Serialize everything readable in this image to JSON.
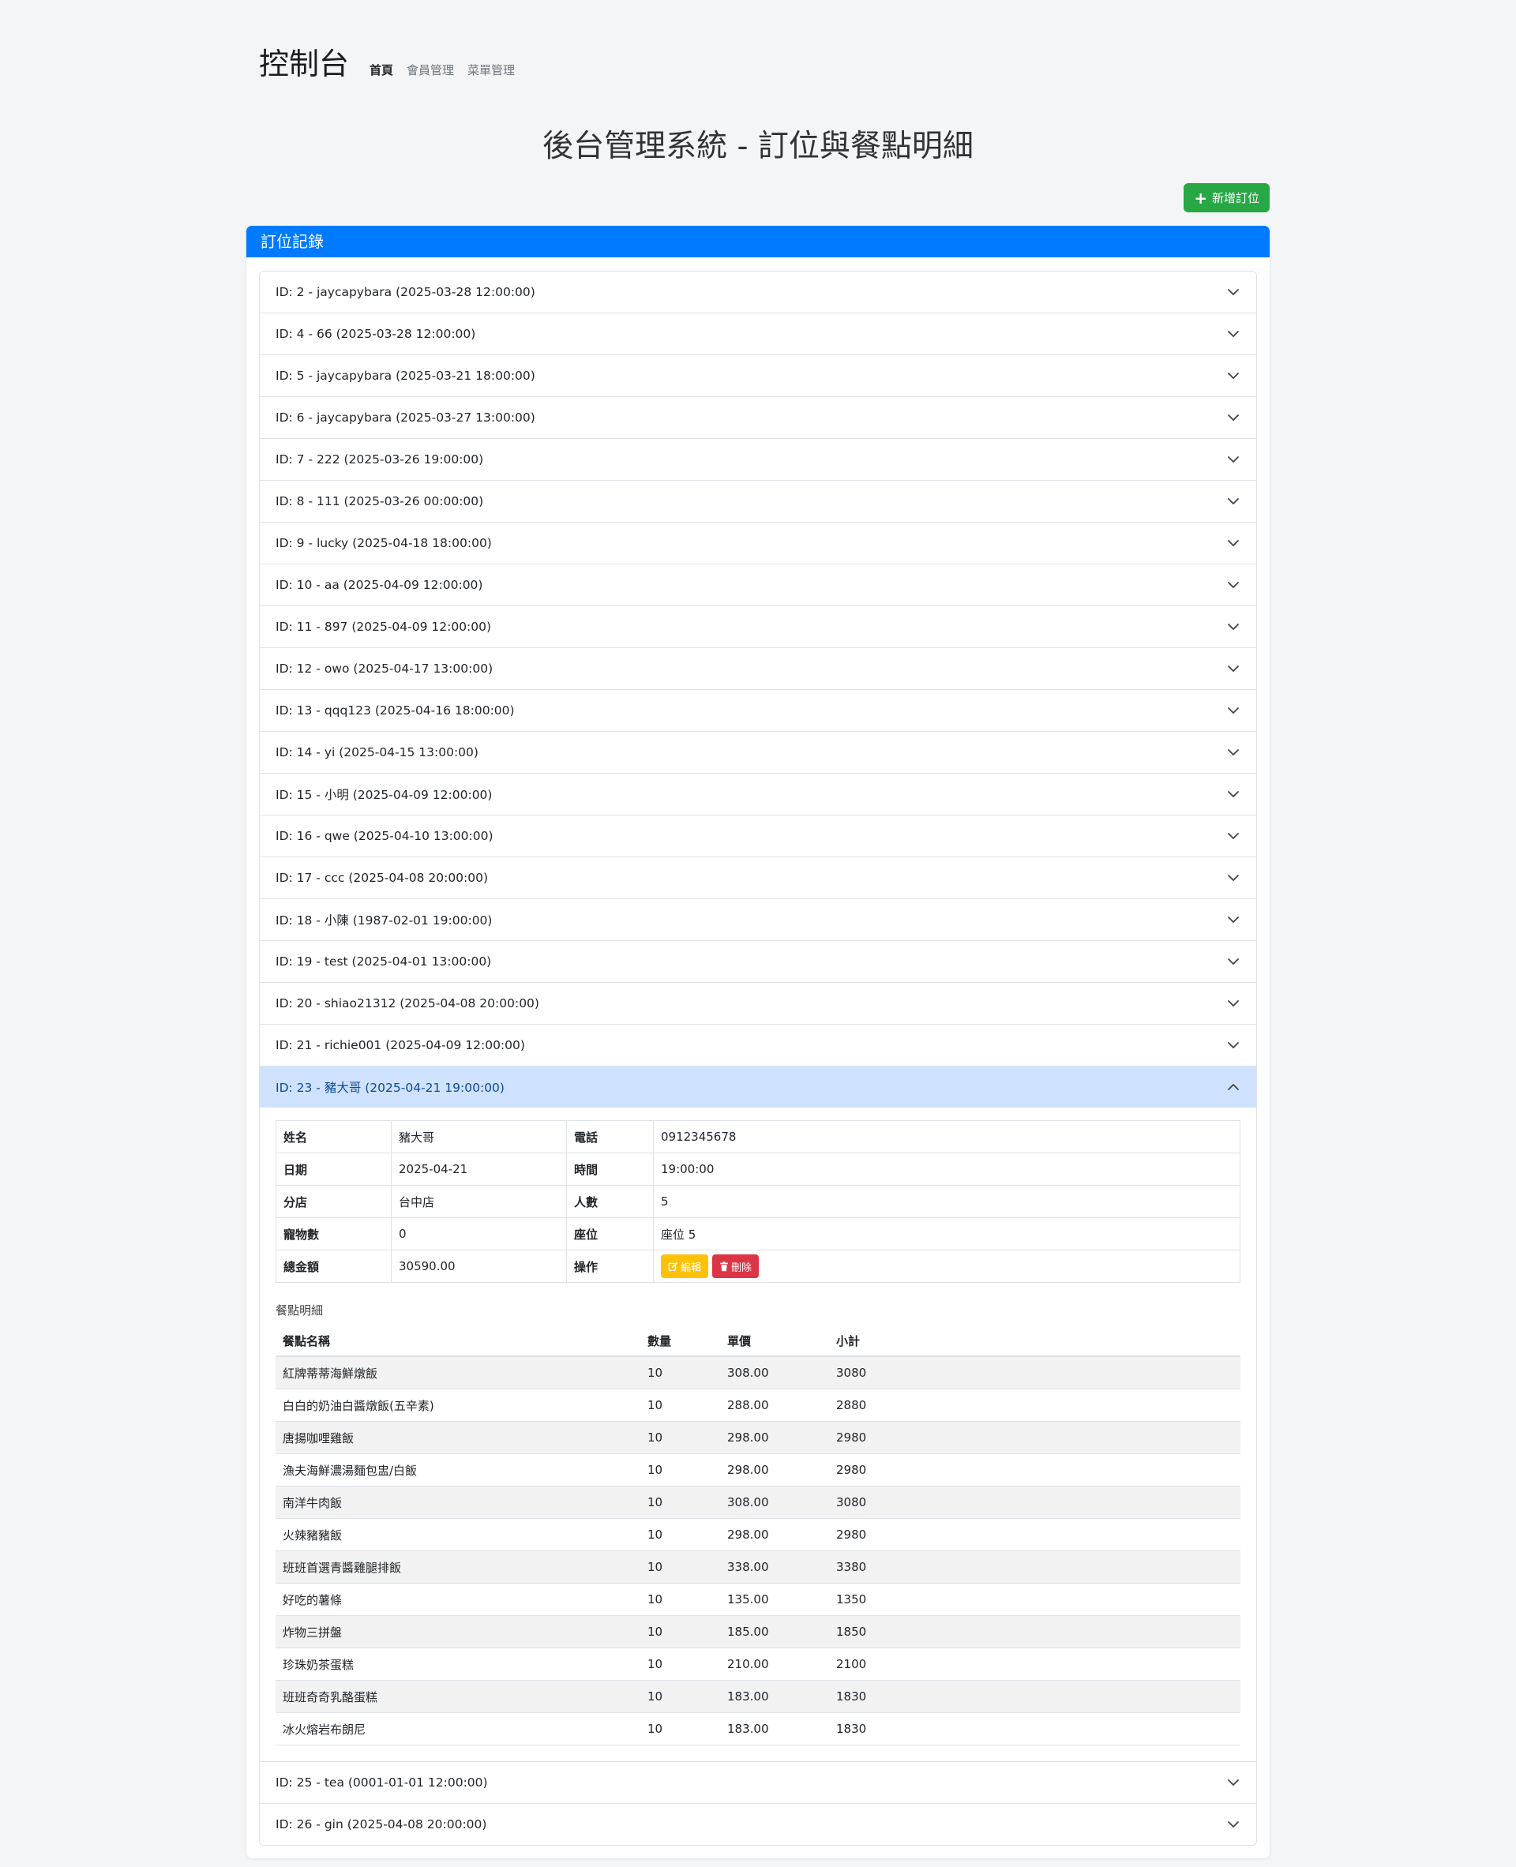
{
  "nav": {
    "brand": "控制台",
    "links": [
      "首頁",
      "會員管理",
      "菜單管理"
    ]
  },
  "page": {
    "title": "後台管理系統 - 訂位與餐點明細",
    "add_button": "新增訂位"
  },
  "reservations": {
    "header": "訂位記錄",
    "items": [
      "ID: 2 - jaycapybara (2025-03-28 12:00:00)",
      "ID: 4 - 66 (2025-03-28 12:00:00)",
      "ID: 5 - jaycapybara (2025-03-21 18:00:00)",
      "ID: 6 - jaycapybara (2025-03-27 13:00:00)",
      "ID: 7 - 222 (2025-03-26 19:00:00)",
      "ID: 8 - 111 (2025-03-26 00:00:00)",
      "ID: 9 - lucky (2025-04-18 18:00:00)",
      "ID: 10 - aa (2025-04-09 12:00:00)",
      "ID: 11 - 897 (2025-04-09 12:00:00)",
      "ID: 12 - owo (2025-04-17 13:00:00)",
      "ID: 13 - qqq123 (2025-04-16 18:00:00)",
      "ID: 14 - yi (2025-04-15 13:00:00)",
      "ID: 15 - 小明 (2025-04-09 12:00:00)",
      "ID: 16 - qwe (2025-04-10 13:00:00)",
      "ID: 17 - ccc (2025-04-08 20:00:00)",
      "ID: 18 - 小陳 (1987-02-01 19:00:00)",
      "ID: 19 - test (2025-04-01 13:00:00)",
      "ID: 20 - shiao21312 (2025-04-08 20:00:00)",
      "ID: 21 - richie001 (2025-04-09 12:00:00)",
      "ID: 23 - 豬大哥 (2025-04-21 19:00:00)",
      "ID: 25 - tea (0001-01-01 12:00:00)",
      "ID: 26 - gin (2025-04-08 20:00:00)"
    ],
    "expanded_index": 19
  },
  "detail": {
    "info_rows": [
      [
        "姓名",
        "豬大哥",
        "電話",
        "0912345678"
      ],
      [
        "日期",
        "2025-04-21",
        "時間",
        "19:00:00"
      ],
      [
        "分店",
        "台中店",
        "人數",
        "5"
      ],
      [
        "寵物數",
        "0",
        "座位",
        "座位 5"
      ],
      [
        "總金額",
        "30590.00",
        "操作",
        ""
      ]
    ],
    "edit_label": "編輯",
    "delete_label": "刪除",
    "items_title": "餐點明細",
    "items_headers": [
      "餐點名稱",
      "數量",
      "單價",
      "小計"
    ],
    "items": [
      [
        "紅牌蒂蒂海鮮燉飯",
        "10",
        "308.00",
        "3080"
      ],
      [
        "白白的奶油白醬燉飯(五辛素)",
        "10",
        "288.00",
        "2880"
      ],
      [
        "唐揚咖哩雞飯",
        "10",
        "298.00",
        "2980"
      ],
      [
        "漁夫海鮮濃湯麵包盅/白飯",
        "10",
        "298.00",
        "2980"
      ],
      [
        "南洋牛肉飯",
        "10",
        "308.00",
        "3080"
      ],
      [
        "火辣豬豬飯",
        "10",
        "298.00",
        "2980"
      ],
      [
        "班班首選青醬雞腿排飯",
        "10",
        "338.00",
        "3380"
      ],
      [
        "好吃的薯條",
        "10",
        "135.00",
        "1350"
      ],
      [
        "炸物三拼盤",
        "10",
        "185.00",
        "1850"
      ],
      [
        "珍珠奶茶蛋糕",
        "10",
        "210.00",
        "2100"
      ],
      [
        "班班奇奇乳酪蛋糕",
        "10",
        "183.00",
        "1830"
      ],
      [
        "冰火熔岩布朗尼",
        "10",
        "183.00",
        "1830"
      ]
    ]
  },
  "colors": {
    "primary": "#007bff",
    "success": "#28a745",
    "warning": "#ffc107",
    "danger": "#dc3545",
    "accordion_active": "#cfe2ff"
  }
}
